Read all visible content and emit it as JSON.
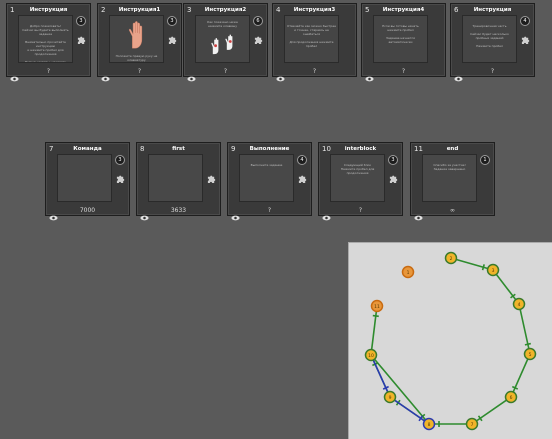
{
  "cards": [
    {
      "num": "1",
      "title": "Инструкция",
      "badge": "3",
      "has_puzzle": true,
      "duration": "?",
      "screen_text": "Добро пожаловать!\nСейчас вы будете выполнять задание\n\nВнимательно прочитайте инструкцию\nи нажмите пробел для продолжения\n\nЕсли вы готовы, нажмите пробел",
      "image": ""
    },
    {
      "num": "2",
      "title": "Инструкция1",
      "badge": "3",
      "has_puzzle": true,
      "duration": "?",
      "screen_text": "Положите правую руку на клавиатуру",
      "image": "hand"
    },
    {
      "num": "3",
      "title": "Инструкция2",
      "badge": "6",
      "has_puzzle": true,
      "duration": "?",
      "screen_text": "Как показано ниже\nнажмите клавишу",
      "image": "hands2"
    },
    {
      "num": "4",
      "title": "Инструкция3",
      "badge": "",
      "has_puzzle": false,
      "duration": "?",
      "screen_text": "Отвечайте как можно быстрее\nи точнее, стараясь не ошибаться\n\nДля продолжения нажмите пробел",
      "image": ""
    },
    {
      "num": "5",
      "title": "Инструкция4",
      "badge": "",
      "has_puzzle": false,
      "duration": "?",
      "screen_text": "Если вы готовы начать\nнажмите пробел\n\nЗадание начнется автоматически",
      "image": ""
    },
    {
      "num": "6",
      "title": "Инструкция",
      "badge": "4",
      "has_puzzle": true,
      "duration": "?",
      "screen_text": "Тренировочная часть\n\nСейчас будет несколько\nпробных заданий\n\nНажмите пробел",
      "image": ""
    }
  ],
  "cards_row2": [
    {
      "num": "7",
      "title": "Команда",
      "badge": "3",
      "has_puzzle": true,
      "duration": "7000",
      "screen_text": ""
    },
    {
      "num": "8",
      "title": "first",
      "badge": "",
      "has_puzzle": true,
      "duration": "3633",
      "screen_text": ""
    },
    {
      "num": "9",
      "title": "Выполнение",
      "badge": "4",
      "has_puzzle": true,
      "duration": "?",
      "screen_text": "Выполните задание"
    },
    {
      "num": "10",
      "title": "interblock",
      "badge": "3",
      "has_puzzle": true,
      "duration": "?",
      "screen_text": "Следующий блок\nНажмите пробел для продолжения"
    },
    {
      "num": "11",
      "title": "end",
      "badge": "1",
      "has_puzzle": false,
      "duration": "∞",
      "screen_text": "Спасибо за участие!\nЗадание завершено"
    }
  ],
  "graph": {
    "nodes": [
      {
        "id": "1",
        "label": "1",
        "fill": "#e8963a",
        "ring": "#c86a10"
      },
      {
        "id": "2",
        "label": "2",
        "fill": "#f0b429",
        "ring": "#3a7a2a"
      },
      {
        "id": "3",
        "label": "3",
        "fill": "#f0b429",
        "ring": "#3a7a2a"
      },
      {
        "id": "4",
        "label": "4",
        "fill": "#f0b429",
        "ring": "#3a7a2a"
      },
      {
        "id": "5",
        "label": "5",
        "fill": "#f0b429",
        "ring": "#3a7a2a"
      },
      {
        "id": "6",
        "label": "6",
        "fill": "#f0b429",
        "ring": "#3a7a2a"
      },
      {
        "id": "7",
        "label": "7",
        "fill": "#f0b429",
        "ring": "#3a7a2a"
      },
      {
        "id": "8",
        "label": "8",
        "fill": "#f0b429",
        "ring": "#2a3ab0"
      },
      {
        "id": "9",
        "label": "9",
        "fill": "#f0b429",
        "ring": "#3a7a2a"
      },
      {
        "id": "10",
        "label": "10",
        "fill": "#f0b429",
        "ring": "#3a7a2a"
      },
      {
        "id": "11",
        "label": "11",
        "fill": "#e8963a",
        "ring": "#c86a10"
      }
    ],
    "edges": [
      {
        "from": "2",
        "to": "3",
        "color": "#2e8b2e"
      },
      {
        "from": "3",
        "to": "4",
        "color": "#2e8b2e"
      },
      {
        "from": "4",
        "to": "5",
        "color": "#2e8b2e"
      },
      {
        "from": "5",
        "to": "6",
        "color": "#2e8b2e"
      },
      {
        "from": "6",
        "to": "7",
        "color": "#2e8b2e"
      },
      {
        "from": "7",
        "to": "8",
        "color": "#2e8b2e"
      },
      {
        "from": "8",
        "to": "9",
        "color": "#2e8b2e"
      },
      {
        "from": "9",
        "to": "10",
        "color": "#2e8b2e"
      },
      {
        "from": "10",
        "to": "8",
        "color": "#2e8b2e"
      },
      {
        "from": "9",
        "to": "8",
        "color": "#2a3ab0"
      },
      {
        "from": "10",
        "to": "9",
        "color": "#2a3ab0"
      },
      {
        "from": "10",
        "to": "11",
        "color": "#2e8b2e"
      }
    ]
  }
}
